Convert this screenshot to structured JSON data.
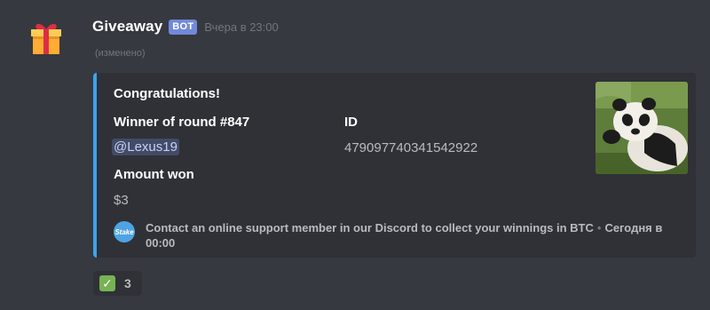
{
  "message": {
    "username": "Giveaway",
    "bot_tag": "BOT",
    "timestamp": "Вчера в 23:00",
    "edited": "(изменено)",
    "avatar_icon": "gift-icon"
  },
  "embed": {
    "accent_color": "#3ba4ec",
    "title": "Congratulations!",
    "fields": [
      {
        "name": "Winner of round #847",
        "value": "@Lexus19"
      },
      {
        "name": "ID",
        "value": "479097740341542922"
      },
      {
        "name": "Amount won",
        "value": "$3"
      }
    ],
    "thumbnail": "panda-image",
    "footer": {
      "icon_text": "Stake",
      "text": "Contact an online support member in our Discord to collect your winnings in BTC",
      "separator": "•",
      "timestamp": "Сегодня в 00:00"
    }
  },
  "reaction": {
    "emoji": "white-check-mark-icon",
    "count": "3"
  }
}
